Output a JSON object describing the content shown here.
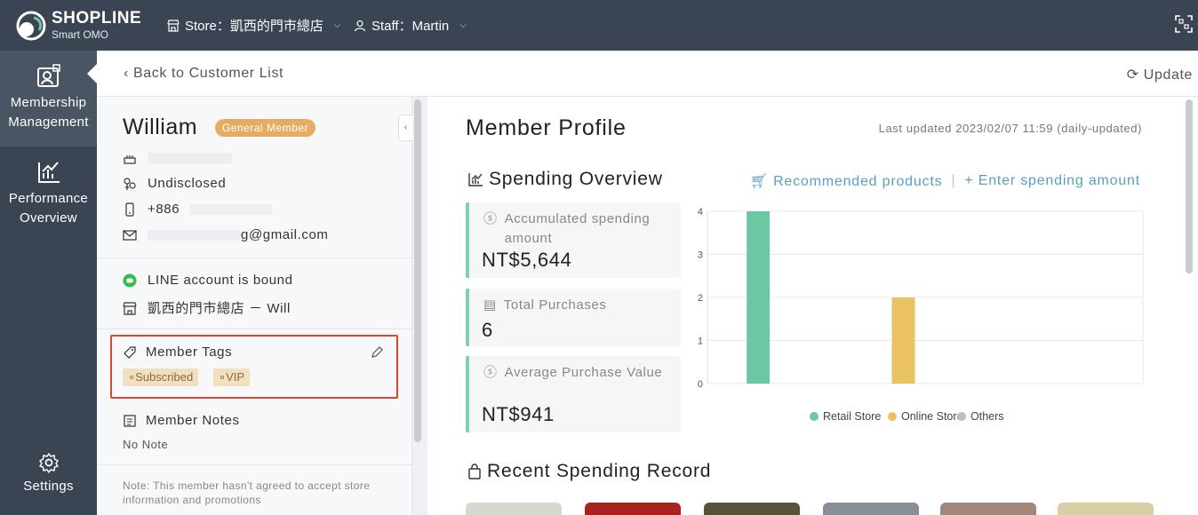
{
  "topbar": {
    "brand": "SHOPLINE",
    "brand_sub": "Smart OMO",
    "store_label": "Store：凱西的門市總店",
    "staff_label": "Staff：Martin"
  },
  "sidebar": {
    "items": [
      {
        "label": "Membership Management",
        "icon": "member-card-icon",
        "active": true
      },
      {
        "label": "Performance Overview",
        "icon": "chart-icon",
        "active": false
      },
      {
        "label": "Settings",
        "icon": "gear-icon",
        "active": false
      }
    ]
  },
  "subheader": {
    "back_label": "Back to Customer List",
    "update_label": "Update"
  },
  "member": {
    "name": "William",
    "tier": "General Member",
    "gender": "Undisclosed",
    "phone_prefix": "+886",
    "email_suffix": "g@gmail.com",
    "line_status": "LINE account is bound",
    "store_staff": "凱西的門市總店 － Will",
    "tags_title": "Member Tags",
    "tags": [
      "Subscribed",
      "VIP"
    ],
    "notes_title": "Member Notes",
    "notes_value": "No Note",
    "consent_note": "Note: This member hasn't agreed to accept store information and promotions"
  },
  "profile": {
    "title": "Member Profile",
    "last_updated": "Last updated 2023/02/07 11:59 (daily-updated)",
    "spending_title": "Spending Overview",
    "recommended_label": "Recommended products",
    "enter_spending_label": "Enter spending amount",
    "recent_title": "Recent Spending Record",
    "stats": [
      {
        "label": "Accumulated spending amount",
        "value": "NT$5,644"
      },
      {
        "label": "Total Purchases",
        "value": "6"
      },
      {
        "label": "Average Purchase Value",
        "value": "NT$941"
      }
    ]
  },
  "chart_data": {
    "type": "bar",
    "categories": [
      "Retail Store",
      "Online Store",
      "Others"
    ],
    "values": [
      4,
      2,
      0
    ],
    "colors": [
      "#6cc7a2",
      "#e9c363",
      "#b9bcc9"
    ],
    "ylim": [
      0,
      4
    ],
    "yticks": [
      "0",
      "1",
      "2",
      "3",
      "4"
    ],
    "legend": [
      "Retail Store",
      "Online Store",
      "Others"
    ],
    "legend_position": "bottom",
    "grid": true
  },
  "colors": {
    "sidebar_bg": "#3a4452",
    "accent_link": "#5a9fbf",
    "badge_bg": "#e6ad62",
    "highlight_border": "#e0452e"
  }
}
